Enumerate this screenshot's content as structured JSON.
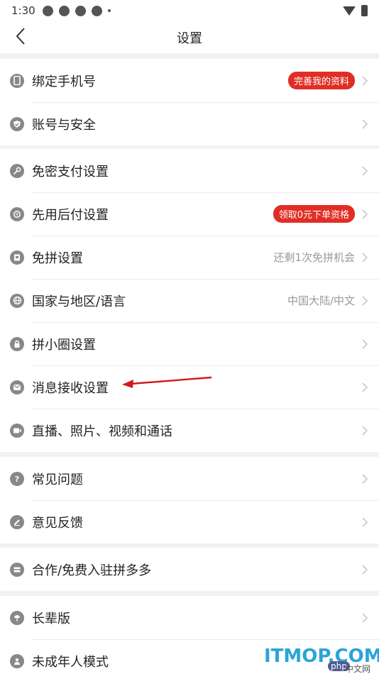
{
  "status_bar": {
    "time": "1:30"
  },
  "nav": {
    "title": "设置"
  },
  "groups": [
    {
      "items": [
        {
          "label": "绑定手机号",
          "badge": "完善我的资料"
        },
        {
          "label": "账号与安全"
        }
      ]
    },
    {
      "items": [
        {
          "label": "免密支付设置"
        },
        {
          "label": "先用后付设置",
          "badge": "领取0元下单资格"
        },
        {
          "label": "免拼设置",
          "hint": "还剩1次免拼机会"
        },
        {
          "label": "国家与地区/语言",
          "hint": "中国大陆/中文"
        },
        {
          "label": "拼小圈设置"
        },
        {
          "label": "消息接收设置"
        },
        {
          "label": "直播、照片、视频和通话"
        }
      ]
    },
    {
      "items": [
        {
          "label": "常见问题"
        },
        {
          "label": "意见反馈"
        }
      ]
    },
    {
      "items": [
        {
          "label": "合作/免费入驻拼多多"
        }
      ]
    },
    {
      "items": [
        {
          "label": "长辈版"
        },
        {
          "label": "未成年人模式"
        }
      ]
    }
  ],
  "watermark": {
    "main": "ITMOP.COM",
    "php": "php",
    "cn": "中文网"
  },
  "colors": {
    "badge": "#e02e24",
    "annotation_arrow": "#d11a1a",
    "watermark": "#2aa4d8"
  }
}
